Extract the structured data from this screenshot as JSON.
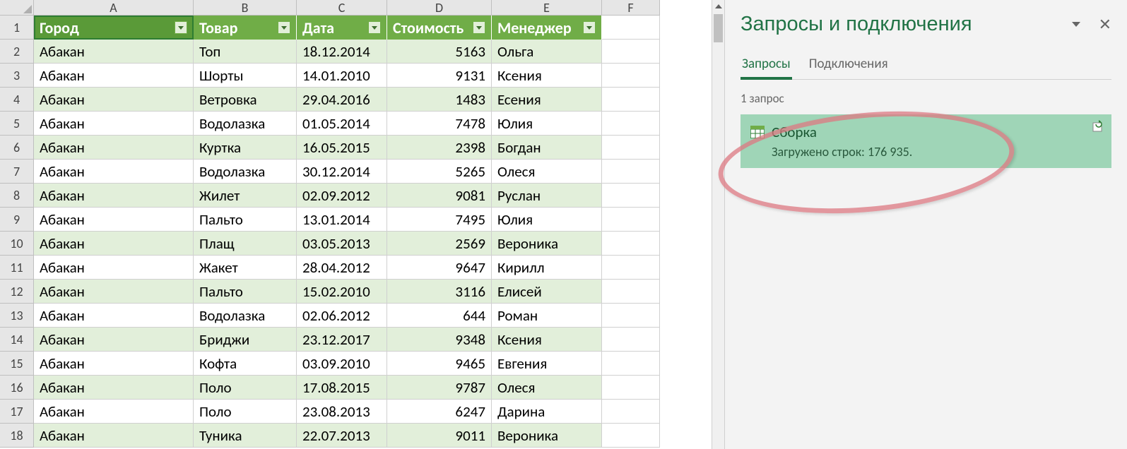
{
  "columns": [
    "A",
    "B",
    "C",
    "D",
    "E",
    "F"
  ],
  "headers": [
    "Город",
    "Товар",
    "Дата",
    "Стоимость",
    "Менеджер"
  ],
  "selected_header_index": 0,
  "rows": [
    {
      "n": 2,
      "city": "Абакан",
      "item": "Топ",
      "date": "18.12.2014",
      "cost": "5163",
      "mgr": "Ольга"
    },
    {
      "n": 3,
      "city": "Абакан",
      "item": "Шорты",
      "date": "14.01.2010",
      "cost": "9131",
      "mgr": "Ксения"
    },
    {
      "n": 4,
      "city": "Абакан",
      "item": "Ветровка",
      "date": "29.04.2016",
      "cost": "1483",
      "mgr": "Есения"
    },
    {
      "n": 5,
      "city": "Абакан",
      "item": "Водолазка",
      "date": "01.05.2014",
      "cost": "7478",
      "mgr": "Юлия"
    },
    {
      "n": 6,
      "city": "Абакан",
      "item": "Куртка",
      "date": "16.05.2015",
      "cost": "2398",
      "mgr": "Богдан"
    },
    {
      "n": 7,
      "city": "Абакан",
      "item": "Водолазка",
      "date": "30.12.2014",
      "cost": "5265",
      "mgr": "Олеся"
    },
    {
      "n": 8,
      "city": "Абакан",
      "item": "Жилет",
      "date": "02.09.2012",
      "cost": "9081",
      "mgr": "Руслан"
    },
    {
      "n": 9,
      "city": "Абакан",
      "item": "Пальто",
      "date": "13.01.2014",
      "cost": "7495",
      "mgr": "Юлия"
    },
    {
      "n": 10,
      "city": "Абакан",
      "item": "Плащ",
      "date": "03.05.2013",
      "cost": "2569",
      "mgr": "Вероника"
    },
    {
      "n": 11,
      "city": "Абакан",
      "item": "Жакет",
      "date": "28.04.2012",
      "cost": "9647",
      "mgr": "Кирилл"
    },
    {
      "n": 12,
      "city": "Абакан",
      "item": "Пальто",
      "date": "15.02.2010",
      "cost": "3116",
      "mgr": "Елисей"
    },
    {
      "n": 13,
      "city": "Абакан",
      "item": "Водолазка",
      "date": "02.06.2012",
      "cost": "644",
      "mgr": "Роман"
    },
    {
      "n": 14,
      "city": "Абакан",
      "item": "Бриджи",
      "date": "23.12.2017",
      "cost": "9348",
      "mgr": "Ксения"
    },
    {
      "n": 15,
      "city": "Абакан",
      "item": "Кофта",
      "date": "03.09.2010",
      "cost": "9465",
      "mgr": "Евгения"
    },
    {
      "n": 16,
      "city": "Абакан",
      "item": "Поло",
      "date": "17.08.2015",
      "cost": "9787",
      "mgr": "Олеся"
    },
    {
      "n": 17,
      "city": "Абакан",
      "item": "Поло",
      "date": "23.08.2013",
      "cost": "6247",
      "mgr": "Дарина"
    },
    {
      "n": 18,
      "city": "Абакан",
      "item": "Туника",
      "date": "22.07.2013",
      "cost": "9011",
      "mgr": "Вероника"
    }
  ],
  "panel": {
    "title": "Запросы и подключения",
    "tabs": [
      "Запросы",
      "Подключения"
    ],
    "active_tab": 0,
    "count_label": "1 запрос",
    "query_name": "Сборка",
    "query_status": "Загружено строк: 176 935."
  }
}
